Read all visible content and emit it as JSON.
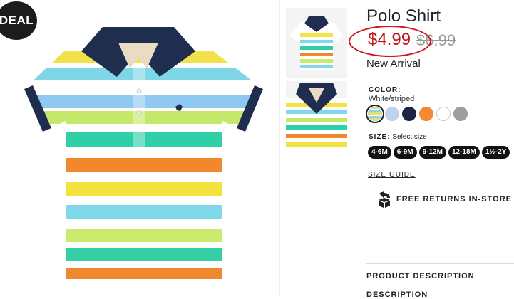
{
  "badge": {
    "label": "DEAL"
  },
  "product": {
    "title": "Polo Shirt",
    "price_sale": "$4.99",
    "price_original": "$6.99",
    "tag": "New Arrival"
  },
  "color": {
    "label": "COLOR:",
    "value": "White/striped",
    "swatches": [
      {
        "name": "white-striped",
        "hex": "#e8e06a"
      },
      {
        "name": "light-blue-print",
        "hex": "#bcd4f0"
      },
      {
        "name": "navy",
        "hex": "#1b2640"
      },
      {
        "name": "orange",
        "hex": "#f28a35"
      },
      {
        "name": "white",
        "hex": "#ffffff"
      },
      {
        "name": "grey",
        "hex": "#9e9e9e"
      }
    ]
  },
  "size": {
    "label": "SIZE:",
    "prompt": "Select size",
    "options": [
      "4-6M",
      "6-9M",
      "9-12M",
      "12-18M",
      "1½-2Y"
    ]
  },
  "links": {
    "size_guide": "SIZE GUIDE",
    "returns": "FREE RETURNS IN-STORE"
  },
  "sections": {
    "product_description": "PRODUCT DESCRIPTION",
    "description": "DESCRIPTION"
  },
  "colors": {
    "sale_price": "#c4141e",
    "annotation_circle": "#d2141e",
    "navy": "#1f2d4f"
  },
  "icons": {
    "returns": "return-box-icon"
  }
}
